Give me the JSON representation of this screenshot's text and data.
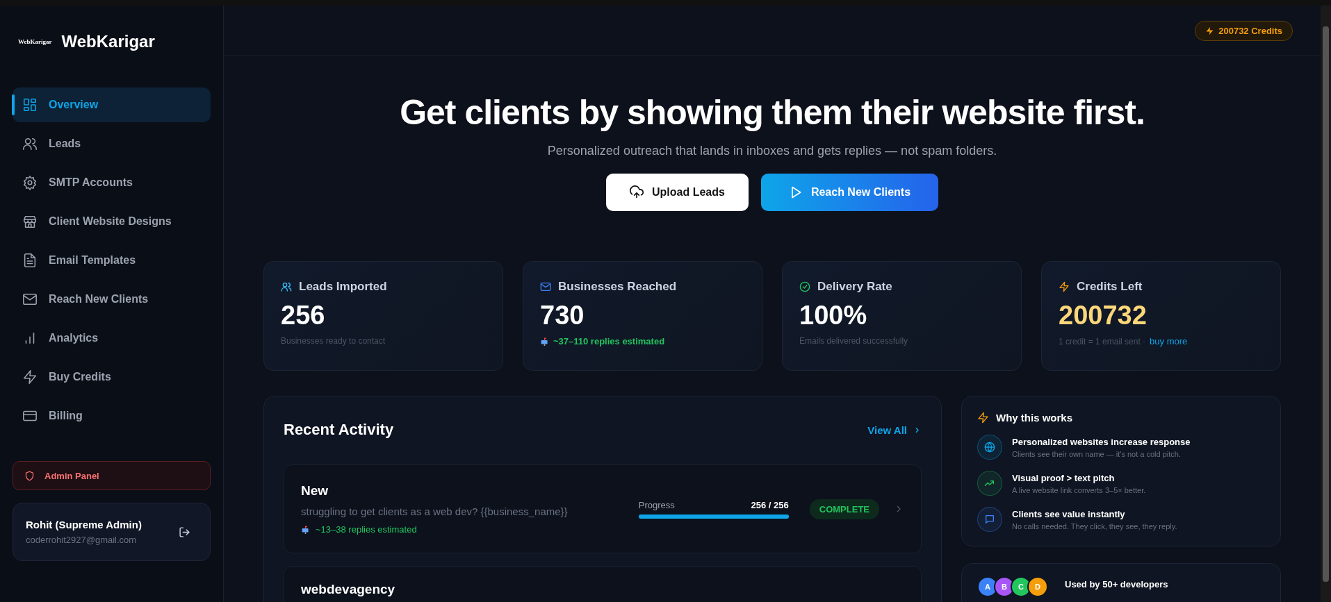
{
  "sidebar": {
    "logo_mark": "WebKarigar",
    "brand": "WebKarigar",
    "items": [
      {
        "label": "Overview",
        "selected": true
      },
      {
        "label": "Leads",
        "selected": false
      },
      {
        "label": "SMTP Accounts",
        "selected": false
      },
      {
        "label": "Client Website Designs",
        "selected": false
      },
      {
        "label": "Email Templates",
        "selected": false
      },
      {
        "label": "Reach New Clients",
        "selected": false
      },
      {
        "label": "Analytics",
        "selected": false
      },
      {
        "label": "Buy Credits",
        "selected": false
      },
      {
        "label": "Billing",
        "selected": false
      }
    ],
    "admin_button": "Admin Panel",
    "user": {
      "name": "Rohit (Supreme Admin)",
      "email": "coderrohit2927@gmail.com"
    }
  },
  "header": {
    "credits_badge": "200732 Credits"
  },
  "hero": {
    "title": "Get clients by showing them their website first.",
    "subtitle": "Personalized outreach that lands in inboxes and gets replies — not spam folders.",
    "buttons": [
      {
        "label": "Upload Leads",
        "kind": "upload"
      },
      {
        "label": "Reach New Clients",
        "kind": "send"
      }
    ]
  },
  "stats": [
    {
      "kind": "leads",
      "label": "Leads Imported",
      "value": "256",
      "note": "Businesses ready to contact"
    },
    {
      "kind": "reached",
      "label": "Businesses Reached",
      "value": "730",
      "note": "~37–110 replies estimated"
    },
    {
      "kind": "rate",
      "label": "Delivery Rate",
      "value": "100%",
      "note": "Emails delivered successfully"
    },
    {
      "kind": "credits",
      "label": "Credits Left",
      "value": "200732",
      "note": "1 credit = 1 email sent ·",
      "link": "buy more"
    }
  ],
  "recent_activity": {
    "title": "Recent Activity",
    "view_all": "View All",
    "rows": [
      {
        "name": "New",
        "subject": "struggling to get clients as a web dev? {{business_name}}",
        "estimate": "~13–38 replies estimated",
        "progress_label": "Progress",
        "progress_text": "256 / 256",
        "level": 1,
        "status": "COMPLETE"
      },
      {
        "name": "webdevagency"
      }
    ]
  },
  "why": {
    "title": "Why this works",
    "items": [
      {
        "kind": "globe",
        "color": "#0ea5e9",
        "title": "Personalized websites increase response",
        "desc": "Clients see their own name — it's not a cold pitch."
      },
      {
        "kind": "trend",
        "color": "#22c55e",
        "title": "Visual proof > text pitch",
        "desc": "A live website link converts 3–5× better."
      },
      {
        "kind": "chat",
        "color": "#3b82f6",
        "title": "Clients see value instantly",
        "desc": "No calls needed. They click, they see, they reply."
      }
    ]
  },
  "social": {
    "avatars": [
      {
        "letter": "A",
        "color": "#3b82f6"
      },
      {
        "letter": "B",
        "color": "#a855f7"
      },
      {
        "letter": "C",
        "color": "#22c55e"
      },
      {
        "letter": "D",
        "color": "#f59e0b"
      }
    ],
    "text": "Used by 50+ developers"
  }
}
